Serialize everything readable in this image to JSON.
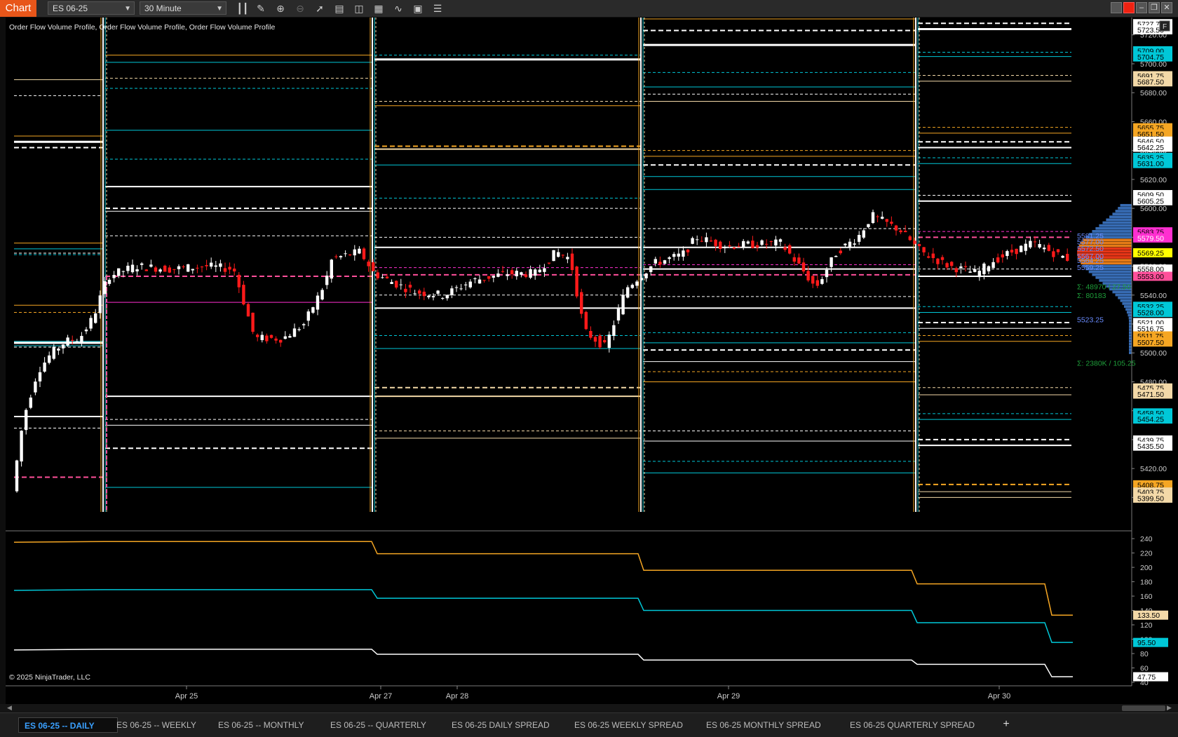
{
  "titlebar": {
    "chart_label": "Chart",
    "instrument": "ES 06-25",
    "interval": "30 Minute",
    "tool_icons": [
      "bar-style-icon",
      "draw-tool-icon",
      "zoom-in-icon",
      "zoom-out-icon",
      "pointer-icon",
      "data-box-icon",
      "properties-icon",
      "indicators-icon",
      "strategies-icon",
      "chart-trader-icon",
      "more-icon"
    ],
    "window_buttons": [
      "restore-icon",
      "red-close-icon",
      "minimize-icon",
      "maximize-icon",
      "close-icon"
    ]
  },
  "indicator_title": "Order Flow Volume Profile, Order Flow Volume Profile, Order Flow Volume Profile",
  "corner_label": "F",
  "copyright": "© 2025 NinjaTrader, LLC",
  "price_axis": {
    "min": 5390,
    "max": 5732,
    "ticks": [
      "5720.00",
      "5700.00",
      "5680.00",
      "5660.00",
      "5640.00",
      "5620.00",
      "5600.00",
      "5580.00",
      "5560.00",
      "5540.00",
      "5520.00",
      "5500.00",
      "5480.00",
      "5460.00",
      "5440.00",
      "5420.00",
      "5400.00"
    ],
    "markers": [
      {
        "text": "5727.75",
        "bg": "#ffffff",
        "fg": "#000"
      },
      {
        "text": "5723.50",
        "bg": "#ffffff",
        "fg": "#000"
      },
      {
        "text": "5709.00",
        "bg": "#00c8d8",
        "fg": "#000"
      },
      {
        "text": "5704.75",
        "bg": "#00c8d8",
        "fg": "#000"
      },
      {
        "text": "5691.75",
        "bg": "#f3d9a8",
        "fg": "#000"
      },
      {
        "text": "5687.50",
        "bg": "#f3d9a8",
        "fg": "#000"
      },
      {
        "text": "5655.75",
        "bg": "#f5a623",
        "fg": "#000"
      },
      {
        "text": "5651.50",
        "bg": "#f5a623",
        "fg": "#000"
      },
      {
        "text": "5646.50",
        "bg": "#ffffff",
        "fg": "#000"
      },
      {
        "text": "5642.25",
        "bg": "#ffffff",
        "fg": "#000"
      },
      {
        "text": "5635.25",
        "bg": "#00c8d8",
        "fg": "#000"
      },
      {
        "text": "5631.00",
        "bg": "#00c8d8",
        "fg": "#000"
      },
      {
        "text": "5609.50",
        "bg": "#ffffff",
        "fg": "#000"
      },
      {
        "text": "5605.25",
        "bg": "#ffffff",
        "fg": "#000"
      },
      {
        "text": "5583.75",
        "bg": "#ff2fd0",
        "fg": "#000"
      },
      {
        "text": "5579.50",
        "bg": "#ff2fd0",
        "fg": "#fff"
      },
      {
        "text": "5569.25",
        "bg": "#ffff00",
        "fg": "#000"
      },
      {
        "text": "5558.00",
        "bg": "#ffffff",
        "fg": "#000"
      },
      {
        "text": "5553.00",
        "bg": "#ff4f9a",
        "fg": "#000"
      },
      {
        "text": "5532.25",
        "bg": "#00c8d8",
        "fg": "#000"
      },
      {
        "text": "5528.00",
        "bg": "#00c8d8",
        "fg": "#000"
      },
      {
        "text": "5521.00",
        "bg": "#ffffff",
        "fg": "#000"
      },
      {
        "text": "5516.75",
        "bg": "#ffffff",
        "fg": "#000"
      },
      {
        "text": "5511.75",
        "bg": "#f5a623",
        "fg": "#000"
      },
      {
        "text": "5507.50",
        "bg": "#f5a623",
        "fg": "#000"
      },
      {
        "text": "5475.75",
        "bg": "#f3d9a8",
        "fg": "#000"
      },
      {
        "text": "5471.50",
        "bg": "#f3d9a8",
        "fg": "#000"
      },
      {
        "text": "5458.50",
        "bg": "#00c8d8",
        "fg": "#000"
      },
      {
        "text": "5454.25",
        "bg": "#00c8d8",
        "fg": "#000"
      },
      {
        "text": "5439.75",
        "bg": "#ffffff",
        "fg": "#000"
      },
      {
        "text": "5435.50",
        "bg": "#ffffff",
        "fg": "#000"
      },
      {
        "text": "5408.75",
        "bg": "#f5a623",
        "fg": "#000"
      },
      {
        "text": "5403.75",
        "bg": "#f3d9a8",
        "fg": "#000"
      },
      {
        "text": "5399.50",
        "bg": "#f3d9a8",
        "fg": "#000"
      }
    ]
  },
  "profile_labels": [
    {
      "text": "5581.25",
      "color": "#6a8cff"
    },
    {
      "text": "5577.00",
      "color": "#6a8cff"
    },
    {
      "text": "5572.50",
      "color": "#6a8cff"
    },
    {
      "text": "5567.00",
      "color": "#6a8cff"
    },
    {
      "text": "5564.25",
      "color": "#6a8cff"
    },
    {
      "text": "5559.25",
      "color": "#6a8cff"
    },
    {
      "text": "Σ: 48970 / 27.50",
      "color": "#1e9e3a"
    },
    {
      "text": "Σ: 80183",
      "color": "#1e9e3a"
    },
    {
      "text": "5523.25",
      "color": "#6a8cff"
    },
    {
      "text": "Σ: 2380K / 105.25",
      "color": "#1e9e3a"
    }
  ],
  "lower_axis": {
    "min": 40,
    "max": 245,
    "ticks": [
      "240",
      "220",
      "200",
      "180",
      "160",
      "140",
      "120",
      "100",
      "80",
      "60",
      "40"
    ],
    "markers": [
      {
        "text": "133.50",
        "bg": "#f3d9a8",
        "fg": "#000"
      },
      {
        "text": "95.50",
        "bg": "#00c8d8",
        "fg": "#000"
      },
      {
        "text": "47.75",
        "bg": "#ffffff",
        "fg": "#000"
      }
    ]
  },
  "time_axis": [
    "Apr 25",
    "Apr 27",
    "Apr 28",
    "Apr 29",
    "Apr 30"
  ],
  "colors": {
    "orange": "#f5a623",
    "cream": "#f3d9a8",
    "cyan": "#00c8d8",
    "white": "#ffffff",
    "magenta": "#ff2fd0",
    "pink": "#ff4f9a",
    "candle_up": "#ffffff",
    "candle_down": "#ff1a1a"
  },
  "tabs": [
    {
      "label": "ES 06-25 -- DAILY",
      "active": true
    },
    {
      "label": "ES 06-25 -- WEEKLY",
      "active": false
    },
    {
      "label": "ES 06-25 -- MONTHLY",
      "active": false
    },
    {
      "label": "ES 06-25 -- QUARTERLY",
      "active": false
    },
    {
      "label": "ES 06-25 DAILY SPREAD",
      "active": false
    },
    {
      "label": "ES 06-25 WEEKLY SPREAD",
      "active": false
    },
    {
      "label": "ES 06-25 MONTHLY SPREAD",
      "active": false
    },
    {
      "label": "ES 06-25 QUARTERLY SPREAD",
      "active": false
    }
  ],
  "add_tab": "+"
}
